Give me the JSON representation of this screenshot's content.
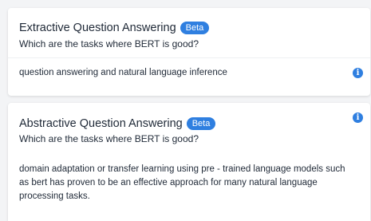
{
  "cards": [
    {
      "title": "Extractive Question Answering",
      "badge": "Beta",
      "question": "Which are the tasks where BERT is good?",
      "answer": "question answering and natural language inference",
      "info_icon": "info-icon"
    },
    {
      "title": "Abstractive Question Answering",
      "badge": "Beta",
      "question": "Which are the tasks where BERT is good?",
      "answer": "domain adaptation or transfer learning using pre - trained language models such as bert has proven to be an effective approach for many natural language processing tasks.",
      "info_icon": "info-icon"
    }
  ],
  "colors": {
    "badge": "#2f7fe0",
    "info_icon": "#2f7fe0",
    "text": "#1f2937",
    "background": "#f3f4f6",
    "card": "#ffffff"
  }
}
